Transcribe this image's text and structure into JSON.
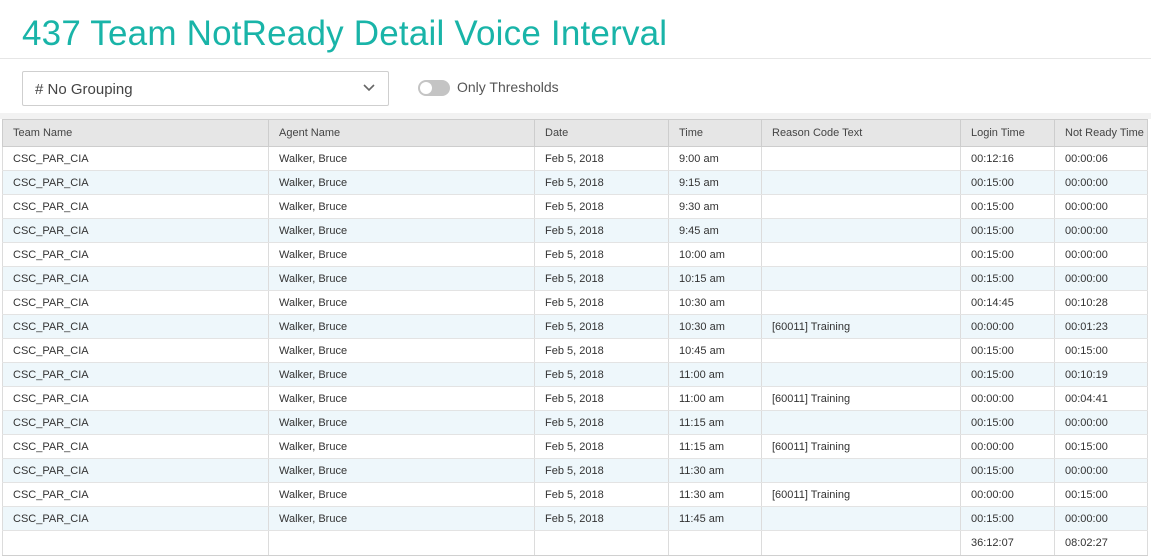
{
  "page": {
    "title": "437 Team NotReady Detail Voice Interval"
  },
  "toolbar": {
    "grouping_value": "# No Grouping",
    "thresholds_label": "Only Thresholds",
    "thresholds_on": false
  },
  "table": {
    "columns": [
      "Team Name",
      "Agent Name",
      "Date",
      "Time",
      "Reason Code Text",
      "Login Time",
      "Not Ready Time"
    ],
    "rows": [
      [
        "CSC_PAR_CIA",
        "Walker, Bruce",
        "Feb 5, 2018",
        "9:00 am",
        "",
        "00:12:16",
        "00:00:06"
      ],
      [
        "CSC_PAR_CIA",
        "Walker, Bruce",
        "Feb 5, 2018",
        "9:15 am",
        "",
        "00:15:00",
        "00:00:00"
      ],
      [
        "CSC_PAR_CIA",
        "Walker, Bruce",
        "Feb 5, 2018",
        "9:30 am",
        "",
        "00:15:00",
        "00:00:00"
      ],
      [
        "CSC_PAR_CIA",
        "Walker, Bruce",
        "Feb 5, 2018",
        "9:45 am",
        "",
        "00:15:00",
        "00:00:00"
      ],
      [
        "CSC_PAR_CIA",
        "Walker, Bruce",
        "Feb 5, 2018",
        "10:00 am",
        "",
        "00:15:00",
        "00:00:00"
      ],
      [
        "CSC_PAR_CIA",
        "Walker, Bruce",
        "Feb 5, 2018",
        "10:15 am",
        "",
        "00:15:00",
        "00:00:00"
      ],
      [
        "CSC_PAR_CIA",
        "Walker, Bruce",
        "Feb 5, 2018",
        "10:30 am",
        "",
        "00:14:45",
        "00:10:28"
      ],
      [
        "CSC_PAR_CIA",
        "Walker, Bruce",
        "Feb 5, 2018",
        "10:30 am",
        "[60011] Training",
        "00:00:00",
        "00:01:23"
      ],
      [
        "CSC_PAR_CIA",
        "Walker, Bruce",
        "Feb 5, 2018",
        "10:45 am",
        "",
        "00:15:00",
        "00:15:00"
      ],
      [
        "CSC_PAR_CIA",
        "Walker, Bruce",
        "Feb 5, 2018",
        "11:00 am",
        "",
        "00:15:00",
        "00:10:19"
      ],
      [
        "CSC_PAR_CIA",
        "Walker, Bruce",
        "Feb 5, 2018",
        "11:00 am",
        "[60011] Training",
        "00:00:00",
        "00:04:41"
      ],
      [
        "CSC_PAR_CIA",
        "Walker, Bruce",
        "Feb 5, 2018",
        "11:15 am",
        "",
        "00:15:00",
        "00:00:00"
      ],
      [
        "CSC_PAR_CIA",
        "Walker, Bruce",
        "Feb 5, 2018",
        "11:15 am",
        "[60011] Training",
        "00:00:00",
        "00:15:00"
      ],
      [
        "CSC_PAR_CIA",
        "Walker, Bruce",
        "Feb 5, 2018",
        "11:30 am",
        "",
        "00:15:00",
        "00:00:00"
      ],
      [
        "CSC_PAR_CIA",
        "Walker, Bruce",
        "Feb 5, 2018",
        "11:30 am",
        "[60011] Training",
        "00:00:00",
        "00:15:00"
      ],
      [
        "CSC_PAR_CIA",
        "Walker, Bruce",
        "Feb 5, 2018",
        "11:45 am",
        "",
        "00:15:00",
        "00:00:00"
      ]
    ],
    "totals": [
      "",
      "",
      "",
      "",
      "",
      "36:12:07",
      "08:02:27"
    ]
  },
  "colors": {
    "accent": "#19b4a8",
    "header_bg": "#e6e6e6",
    "row_alt": "#eef7fb",
    "toggle_off": "#c4c4c4"
  },
  "icons": {
    "dropdown": "chevron-down-icon"
  }
}
